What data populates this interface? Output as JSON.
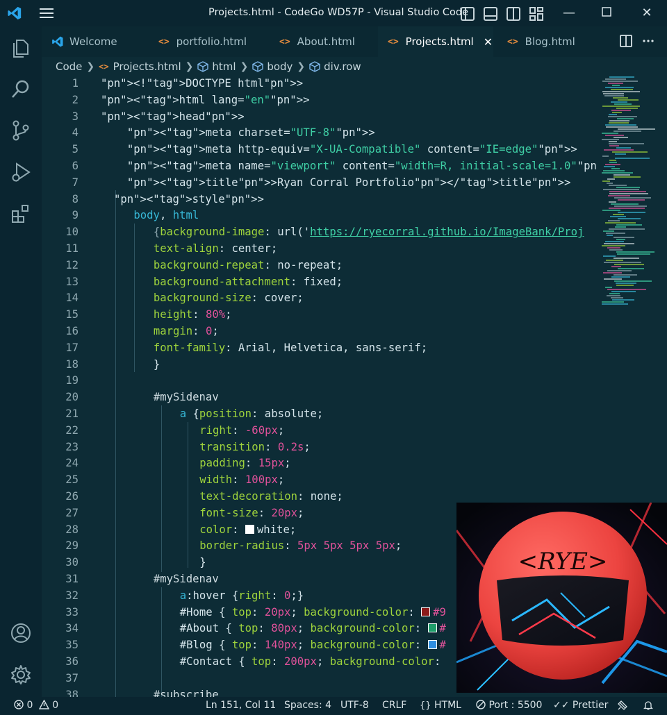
{
  "window": {
    "title": "Projects.html - CodeGo WD57P - Visual Studio Code",
    "accent": "#0a2530",
    "editor_bg": "#0d2c36"
  },
  "activity_bar": [
    "explorer-icon",
    "search-icon",
    "source-control-icon",
    "run-debug-icon",
    "extensions-icon",
    "account-icon",
    "settings-gear-icon"
  ],
  "tabs": [
    {
      "label": "Welcome",
      "icon": "vscode-icon"
    },
    {
      "label": "portfolio.html",
      "icon": "html-icon"
    },
    {
      "label": "About.html",
      "icon": "html-icon"
    },
    {
      "label": "Projects.html",
      "icon": "html-icon",
      "active": true
    },
    {
      "label": "Blog.html",
      "icon": "html-icon"
    }
  ],
  "breadcrumb": [
    "Code",
    "Projects.html",
    "html",
    "body",
    "div.row"
  ],
  "code_lines": [
    {
      "n": "1",
      "text": "<!DOCTYPE html>"
    },
    {
      "n": "2",
      "text": "<html lang=\"en\">"
    },
    {
      "n": "3",
      "text": "<head>"
    },
    {
      "n": "4",
      "text": "<meta charset=\"UTF-8\">"
    },
    {
      "n": "5",
      "text": "<meta http-equiv=\"X-UA-Compatible\" content=\"IE=edge\">"
    },
    {
      "n": "6",
      "text": "<meta name=\"viewport\" content=\"width=R, initial-scale=1.0\">"
    },
    {
      "n": "7",
      "text": "<title>Ryan Corral Portfolio</title>"
    },
    {
      "n": "8",
      "text": "<style>"
    },
    {
      "n": "9",
      "text": "body, html"
    },
    {
      "n": "10",
      "text": "{background-image: url('https://ryecorral.github.io/ImageBank/Proj"
    },
    {
      "n": "11",
      "text": "text-align: center;"
    },
    {
      "n": "12",
      "text": "background-repeat: no-repeat;"
    },
    {
      "n": "13",
      "text": "background-attachment: fixed;"
    },
    {
      "n": "14",
      "text": "background-size: cover;"
    },
    {
      "n": "15",
      "text": "height: 80%;"
    },
    {
      "n": "16",
      "text": "margin: 0;"
    },
    {
      "n": "17",
      "text": "font-family: Arial, Helvetica, sans-serif;"
    },
    {
      "n": "18",
      "text": "}"
    },
    {
      "n": "19",
      "text": ""
    },
    {
      "n": "20",
      "text": "#mySidenav"
    },
    {
      "n": "21",
      "text": "a {position: absolute;"
    },
    {
      "n": "22",
      "text": "right: -60px;"
    },
    {
      "n": "23",
      "text": "transition: 0.2s;"
    },
    {
      "n": "24",
      "text": "padding: 15px;"
    },
    {
      "n": "25",
      "text": "width: 100px;"
    },
    {
      "n": "26",
      "text": "text-decoration: none;"
    },
    {
      "n": "27",
      "text": "font-size: 20px;"
    },
    {
      "n": "28",
      "text": "color: white;"
    },
    {
      "n": "29",
      "text": "border-radius: 5px 5px 5px 5px;"
    },
    {
      "n": "30",
      "text": "}"
    },
    {
      "n": "31",
      "text": "#mySidenav"
    },
    {
      "n": "32",
      "text": "a:hover {right: 0;}"
    },
    {
      "n": "33",
      "text": "#Home { top: 20px; background-color: #9"
    },
    {
      "n": "34",
      "text": "#About { top: 80px; background-color: #"
    },
    {
      "n": "35",
      "text": "#Blog { top: 140px; background-color: #"
    },
    {
      "n": "36",
      "text": "#Contact { top: 200px; background-color:"
    },
    {
      "n": "37",
      "text": ""
    },
    {
      "n": "38",
      "text": "#subscribe"
    }
  ],
  "swatches": {
    "home": "#8b1a1a",
    "about": "#1e9e6a",
    "blog": "#2e8fe0",
    "white": "#ffffff"
  },
  "overlay": {
    "logo_text": "<RYE>",
    "sphere_color": "#e8413f"
  },
  "status_bar": {
    "errors": "0",
    "warnings": "0",
    "position": "Ln 151, Col 11",
    "spaces": "Spaces: 4",
    "encoding": "UTF-8",
    "eol": "CRLF",
    "language": "HTML",
    "port": "Port : 5500",
    "formatter": "Prettier"
  }
}
